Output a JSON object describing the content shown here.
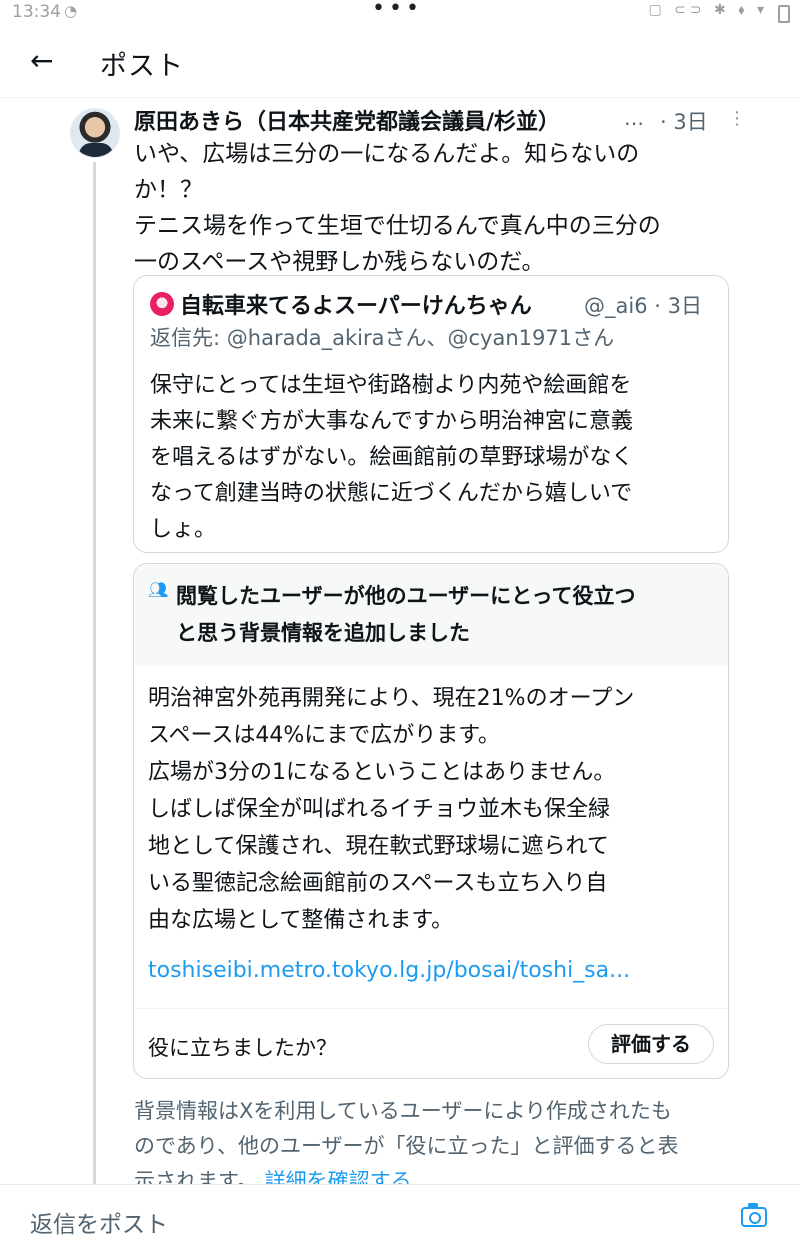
{
  "status_bar": {
    "time": "13:34",
    "dots": "•••"
  },
  "header": {
    "back_icon": "←",
    "title": "ポスト"
  },
  "post": {
    "author": "原田あきら（日本共産党都議会議員/杉並）",
    "ellipsis": "…",
    "time": "· 3日",
    "more_icon": "⋮",
    "text_lines": [
      "いや、広場は三分の一になるんだよ。知らないの",
      "か！？",
      "テニス場を作って生垣で仕切るんで真ん中の三分の",
      "一のスペースや視野しか残らないのだ。"
    ]
  },
  "quote": {
    "name": "自転車来てるよスーパーけんちゃん",
    "handle": "@_ai6 · 3日",
    "reply_prefix": "返信先:",
    "reply_to": "@harada_akiraさん、@cyan1971さん",
    "text_lines": [
      "保守にとっては生垣や街路樹より内苑や絵画館を",
      "未来に繋ぐ方が大事なんですから明治神宮に意義",
      "を唱えるはずがない。絵画館前の草野球場がなく",
      "なって創建当時の状態に近づくんだから嬉しいで",
      "しょ。"
    ]
  },
  "community_note": {
    "title_lines": [
      "閲覧したユーザーが他のユーザーにとって役立つ",
      "と思う背景情報を追加しました"
    ],
    "body_lines": [
      "明治神宮外苑再開発により、現在21%のオープン",
      "スペースは44%にまで広がります。",
      "広場が3分の1になるということはありません。",
      "しばしば保全が叫ばれるイチョウ並木も保全緑",
      "地として保護され、現在軟式野球場に遮られて",
      "いる聖徳記念絵画館前のスペースも立ち入り自",
      "由な広場として整備されます。"
    ],
    "link": "toshiseibi.metro.tokyo.lg.jp/bosai/toshi_sa...",
    "question": "役に立ちましたか？",
    "rate_button": "評価する"
  },
  "footnote": {
    "line1": "背景情報はXを利用しているユーザーにより作成されたも",
    "line2": "のであり、他のユーザーが「役に立った」と評価すると表",
    "line3": "示されます。",
    "more_link": "詳細を確認する"
  },
  "reply_bar": {
    "placeholder": "返信をポスト"
  },
  "colors": {
    "accent": "#1d9bf0",
    "text": "#0f1419",
    "muted": "#536471",
    "border": "#cfd9de",
    "note_header_bg": "#f7f9f9"
  }
}
